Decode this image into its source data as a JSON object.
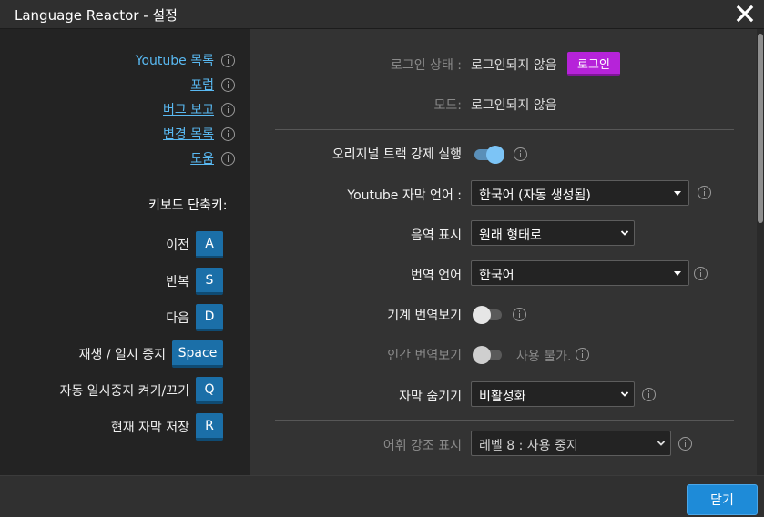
{
  "window": {
    "title": "Language Reactor - 설정"
  },
  "sidebar": {
    "links": [
      {
        "label": "Youtube 목록"
      },
      {
        "label": "포럼"
      },
      {
        "label": "버그 보고"
      },
      {
        "label": "변경 목록"
      },
      {
        "label": "도움"
      }
    ],
    "shortcuts_title": "키보드 단축키:",
    "shortcuts": [
      {
        "label": "이전",
        "key": "A"
      },
      {
        "label": "반복",
        "key": "S"
      },
      {
        "label": "다음",
        "key": "D"
      },
      {
        "label": "재생 / 일시 중지",
        "key": "Space"
      },
      {
        "label": "자동 일시중지 켜기/끄기",
        "key": "Q"
      },
      {
        "label": "현재 자막 저장",
        "key": "R"
      }
    ]
  },
  "settings": {
    "login_status_label": "로그인 상태 :",
    "login_status_value": "로그인되지 않음",
    "login_button": "로그인",
    "mode_label": "모드:",
    "mode_value": "로그인되지 않음",
    "original_highlight_label": "오리지널 트랙 강제 실행",
    "original_highlight_on": true,
    "youtube_sub_lang_label": "Youtube 자막 언어 :",
    "youtube_sub_lang_value": "한국어 (자동 생성됨)",
    "transliteration_label": "음역 표시",
    "transliteration_value": "원래 형태로",
    "translation_lang_label": "번역 언어",
    "translation_lang_value": "한국어",
    "machine_translation_label": "기계 번역보기",
    "machine_translation_on": false,
    "human_translation_label": "인간 번역보기",
    "human_translation_on": false,
    "human_translation_note": "사용 불가.",
    "hide_subs_label": "자막 숨기기",
    "hide_subs_value": "비활성화",
    "vocab_highlight_label": "어휘 강조 표시",
    "vocab_highlight_value": "레벨 8 : 사용 중지"
  },
  "footer": {
    "close_button": "닫기"
  },
  "colors": {
    "accent": "#1e8bd8",
    "login": "#b623d9",
    "link": "#59b9f2",
    "key": "#1b6fa8"
  }
}
